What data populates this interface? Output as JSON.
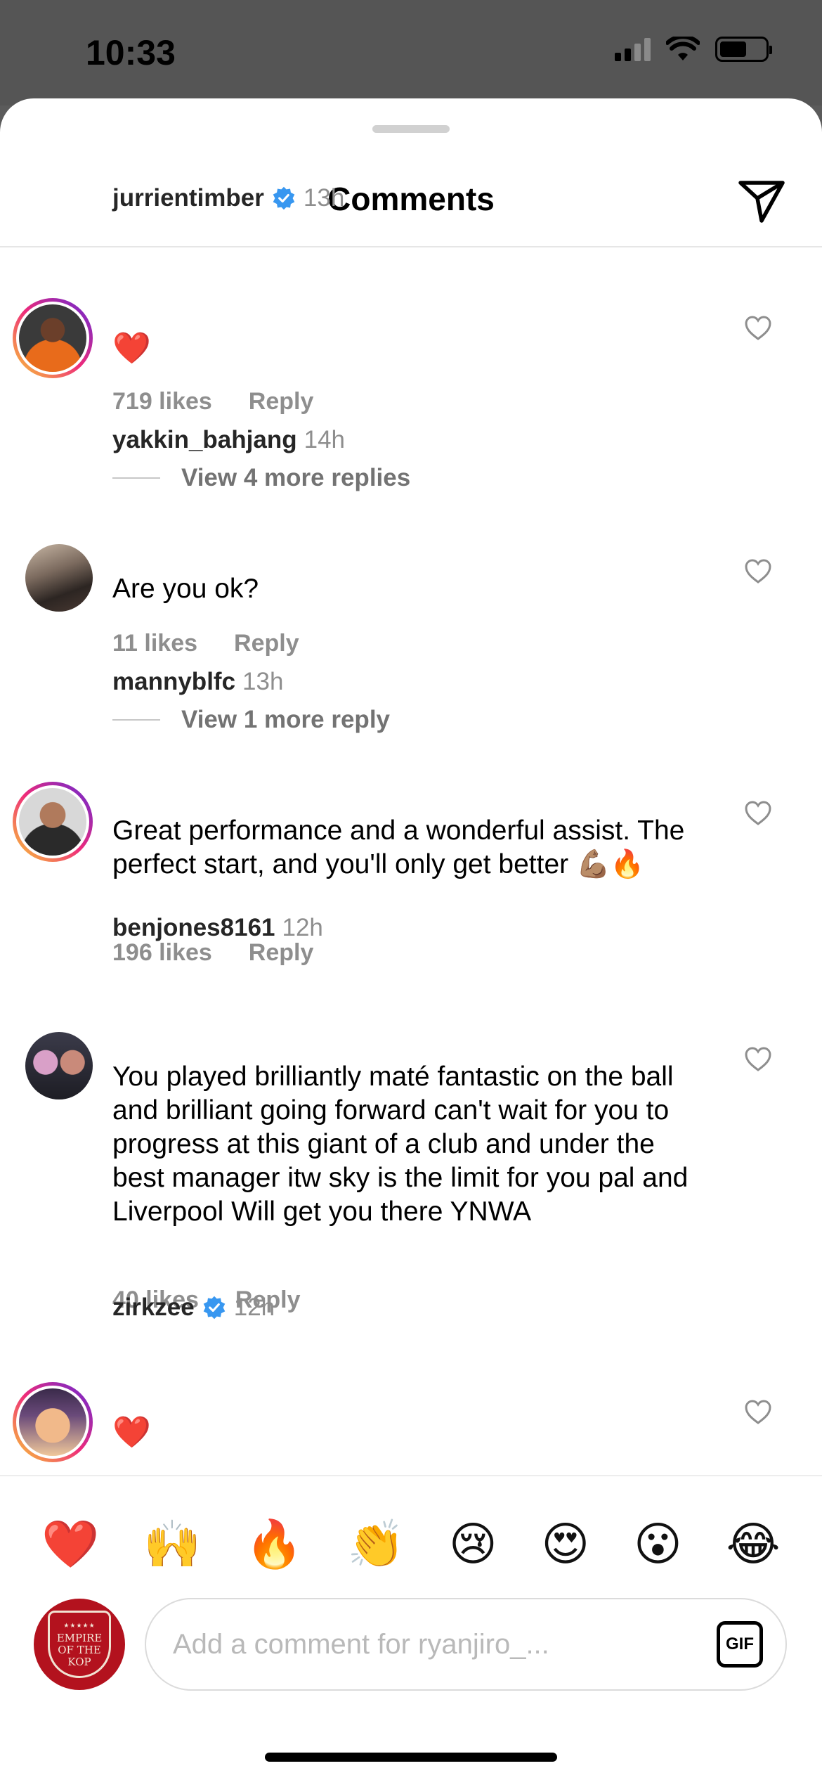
{
  "status_bar": {
    "time": "10:33"
  },
  "header": {
    "title": "Comments"
  },
  "comments": [
    {
      "username": "jurrientimber",
      "verified": true,
      "time": "13h",
      "text": "❤️",
      "likes": "719 likes",
      "reply": "Reply",
      "view_replies": "View 4 more replies"
    },
    {
      "username": "yakkin_bahjang",
      "verified": false,
      "time": "14h",
      "text": "Are you ok?",
      "likes": "11 likes",
      "reply": "Reply",
      "view_replies": "View 1 more reply"
    },
    {
      "username": "mannyblfc",
      "verified": false,
      "time": "13h",
      "text": "Great performance and a wonderful assist. The perfect start, and you'll only get better 💪🏽🔥",
      "likes": "196 likes",
      "reply": "Reply"
    },
    {
      "username": "benjones8161",
      "verified": false,
      "time": "12h",
      "text": "You played brilliantly maté fantastic on the ball and brilliant going forward can't wait for you to progress at this giant of a club and under the best manager itw sky is the limit for you pal and Liverpool Will get you there YNWA",
      "likes": "40 likes",
      "reply": "Reply"
    },
    {
      "username": "zirkzee",
      "verified": true,
      "time": "12h",
      "text": "❤️"
    }
  ],
  "reactions": [
    "❤️",
    "🙌",
    "🔥",
    "👏",
    "😢",
    "😍",
    "😮",
    "😂"
  ],
  "composer": {
    "placeholder": "Add a comment for ryanjiro_...",
    "gif_label": "GIF",
    "avatar_text": [
      "EMPIRE",
      "OF THE",
      "KOP"
    ]
  },
  "colors": {
    "verified": "#3897f0",
    "muted": "#8e8e8e",
    "heart": "#e0245e"
  }
}
